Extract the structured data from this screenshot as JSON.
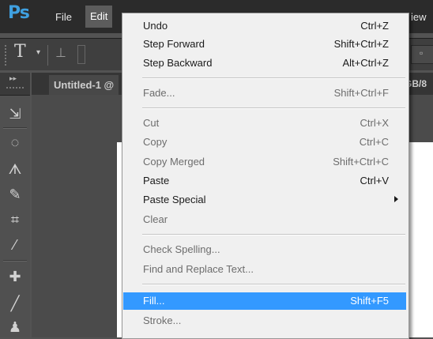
{
  "app": {
    "logo": "Ps"
  },
  "menubar": {
    "file": "File",
    "edit": "Edit",
    "view_partial": "iew"
  },
  "options": {
    "type_tool_glyph": "T"
  },
  "document": {
    "tab_title": "Untitled-1 @",
    "tab_mode_partial": "GB/8"
  },
  "edit_menu": {
    "items": [
      {
        "label": "Undo",
        "shortcut": "Ctrl+Z",
        "enabled": true
      },
      {
        "label": "Step Forward",
        "shortcut": "Shift+Ctrl+Z",
        "enabled": true
      },
      {
        "label": "Step Backward",
        "shortcut": "Alt+Ctrl+Z",
        "enabled": true
      },
      {
        "label": "Fade...",
        "shortcut": "Shift+Ctrl+F",
        "enabled": false
      },
      {
        "label": "Cut",
        "shortcut": "Ctrl+X",
        "enabled": false
      },
      {
        "label": "Copy",
        "shortcut": "Ctrl+C",
        "enabled": false
      },
      {
        "label": "Copy Merged",
        "shortcut": "Shift+Ctrl+C",
        "enabled": false
      },
      {
        "label": "Paste",
        "shortcut": "Ctrl+V",
        "enabled": true
      },
      {
        "label": "Paste Special",
        "shortcut": "",
        "enabled": true,
        "submenu": true
      },
      {
        "label": "Clear",
        "shortcut": "",
        "enabled": false
      },
      {
        "label": "Check Spelling...",
        "shortcut": "",
        "enabled": false
      },
      {
        "label": "Find and Replace Text...",
        "shortcut": "",
        "enabled": false
      },
      {
        "label": "Fill...",
        "shortcut": "Shift+F5",
        "enabled": true,
        "highlighted": true
      },
      {
        "label": "Stroke...",
        "shortcut": "",
        "enabled": false
      }
    ]
  },
  "tools": [
    "move-tool-icon",
    "marquee-tool-icon",
    "lasso-tool-icon",
    "quick-selection-tool-icon",
    "crop-tool-icon",
    "eyedropper-tool-icon",
    "healing-brush-tool-icon",
    "brush-tool-icon",
    "clone-stamp-tool-icon"
  ],
  "colors": {
    "menu_highlight": "#3399ff",
    "ps_logo": "#3fa0e0",
    "menubar_bg": "#2b2b2b"
  }
}
